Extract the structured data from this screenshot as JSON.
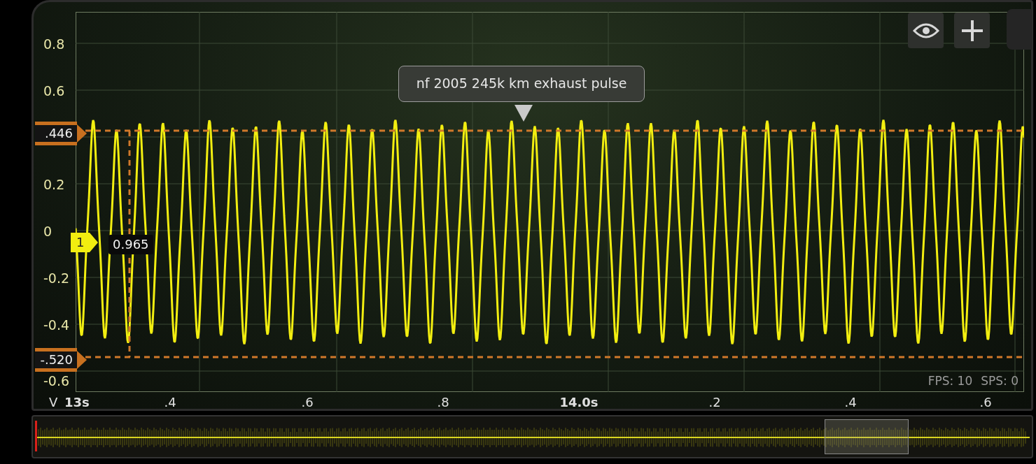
{
  "trace_label": "nf 2005 245k km exhaust pulse",
  "y_axis": {
    "ticks": [
      "0.8",
      "0.6",
      "0.2",
      "0",
      "-0.2",
      "-0.4",
      "-0.6"
    ]
  },
  "x_axis": {
    "unit": "V",
    "ticks": [
      {
        "label": "13s",
        "major": true
      },
      {
        "label": ".4",
        "major": false
      },
      {
        "label": ".6",
        "major": false
      },
      {
        "label": ".8",
        "major": false
      },
      {
        "label": "14.0s",
        "major": true
      },
      {
        "label": ".2",
        "major": false
      },
      {
        "label": ".4",
        "major": false
      },
      {
        "label": ".6",
        "major": false
      }
    ]
  },
  "cursors": [
    {
      "label": ".446"
    },
    {
      "label": "-.520"
    }
  ],
  "channel": {
    "label": "1",
    "value": "0.965"
  },
  "stats": [
    "FPS: 10",
    "SPS: 0"
  ]
}
